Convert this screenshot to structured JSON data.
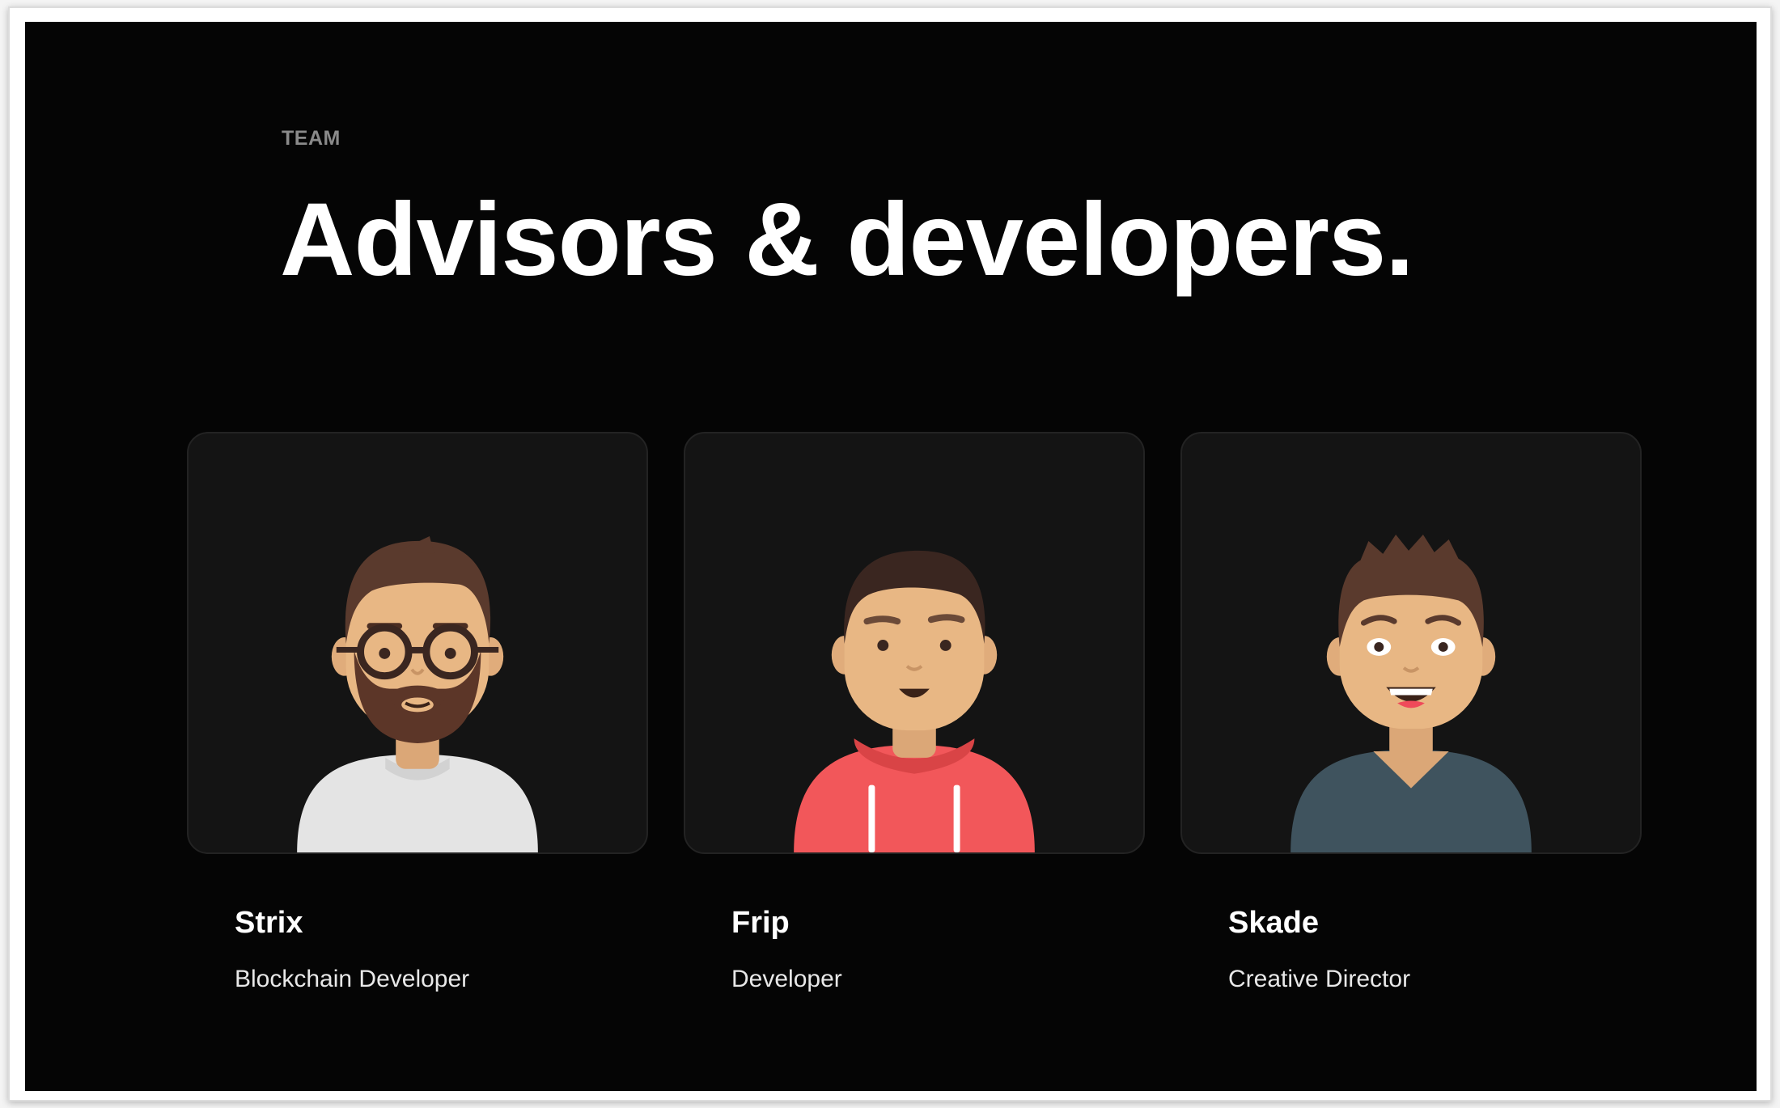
{
  "section": {
    "eyebrow": "TEAM",
    "title": "Advisors & developers."
  },
  "members": [
    {
      "name": "Strix",
      "role": "Blockchain Developer",
      "avatar": "bearded-man-with-glasses",
      "shirt_color": "#e4e4e4"
    },
    {
      "name": "Frip",
      "role": "Developer",
      "avatar": "man-in-red-hoodie",
      "shirt_color": "#f2575a"
    },
    {
      "name": "Skade",
      "role": "Creative Director",
      "avatar": "spiky-hair-man-smiling",
      "shirt_color": "#3f535e"
    }
  ],
  "colors": {
    "background": "#050505",
    "card": "#141414",
    "skin": "#e8b784",
    "hair": "#3a2620"
  }
}
